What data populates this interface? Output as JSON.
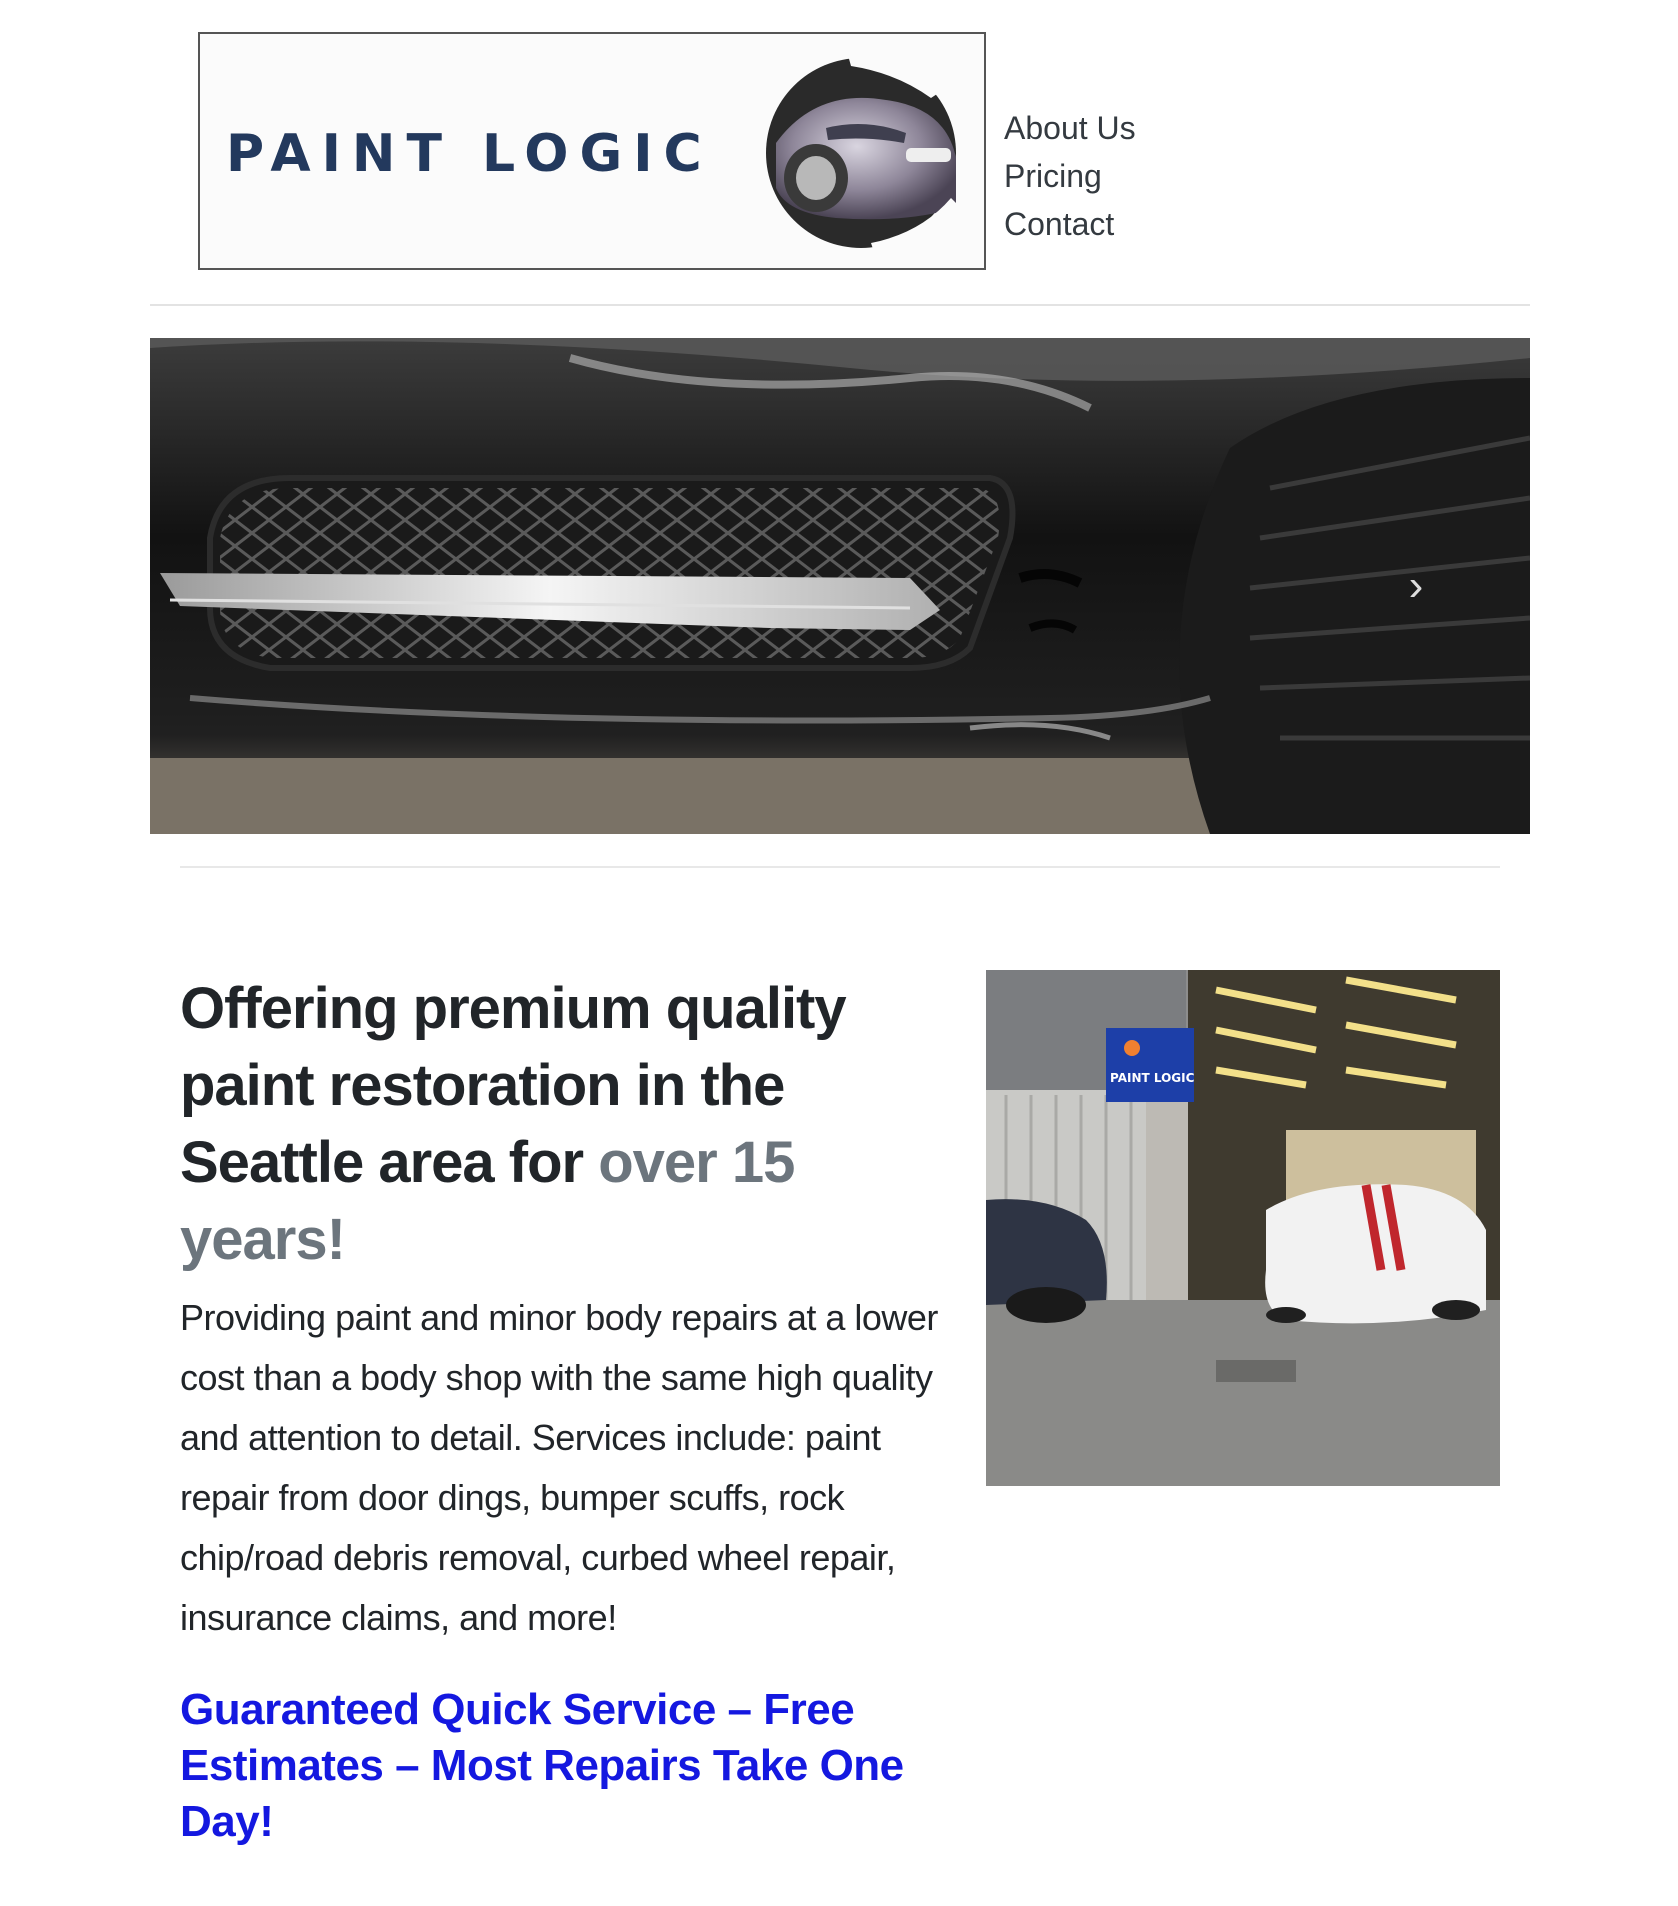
{
  "brand": {
    "logo_text": "PAINT LOGIC",
    "primary_color": "#23395d",
    "link_color": "#1418e0",
    "muted_color": "#6c757d"
  },
  "nav": {
    "items": [
      {
        "label": "About Us"
      },
      {
        "label": "Pricing"
      },
      {
        "label": "Contact"
      }
    ]
  },
  "hero": {
    "next_icon": "chevron-right-icon",
    "next_glyph": "›"
  },
  "intro": {
    "headline_start": "Offering premium quality paint restoration in the Seattle area for ",
    "headline_highlight": "over 15 years!",
    "body": "Providing paint and minor body repairs at a lower cost than a body shop with the same high quality and attention to detail. Services include: paint repair from door dings, bumper scuffs, rock chip/road debris removal, curbed wheel repair, insurance claims, and more!",
    "cta": "Guaranteed Quick Service – Free Estimates – Most Repairs Take One Day!"
  },
  "shop_photo": {
    "sign_text": "PAINT LOGIC"
  }
}
